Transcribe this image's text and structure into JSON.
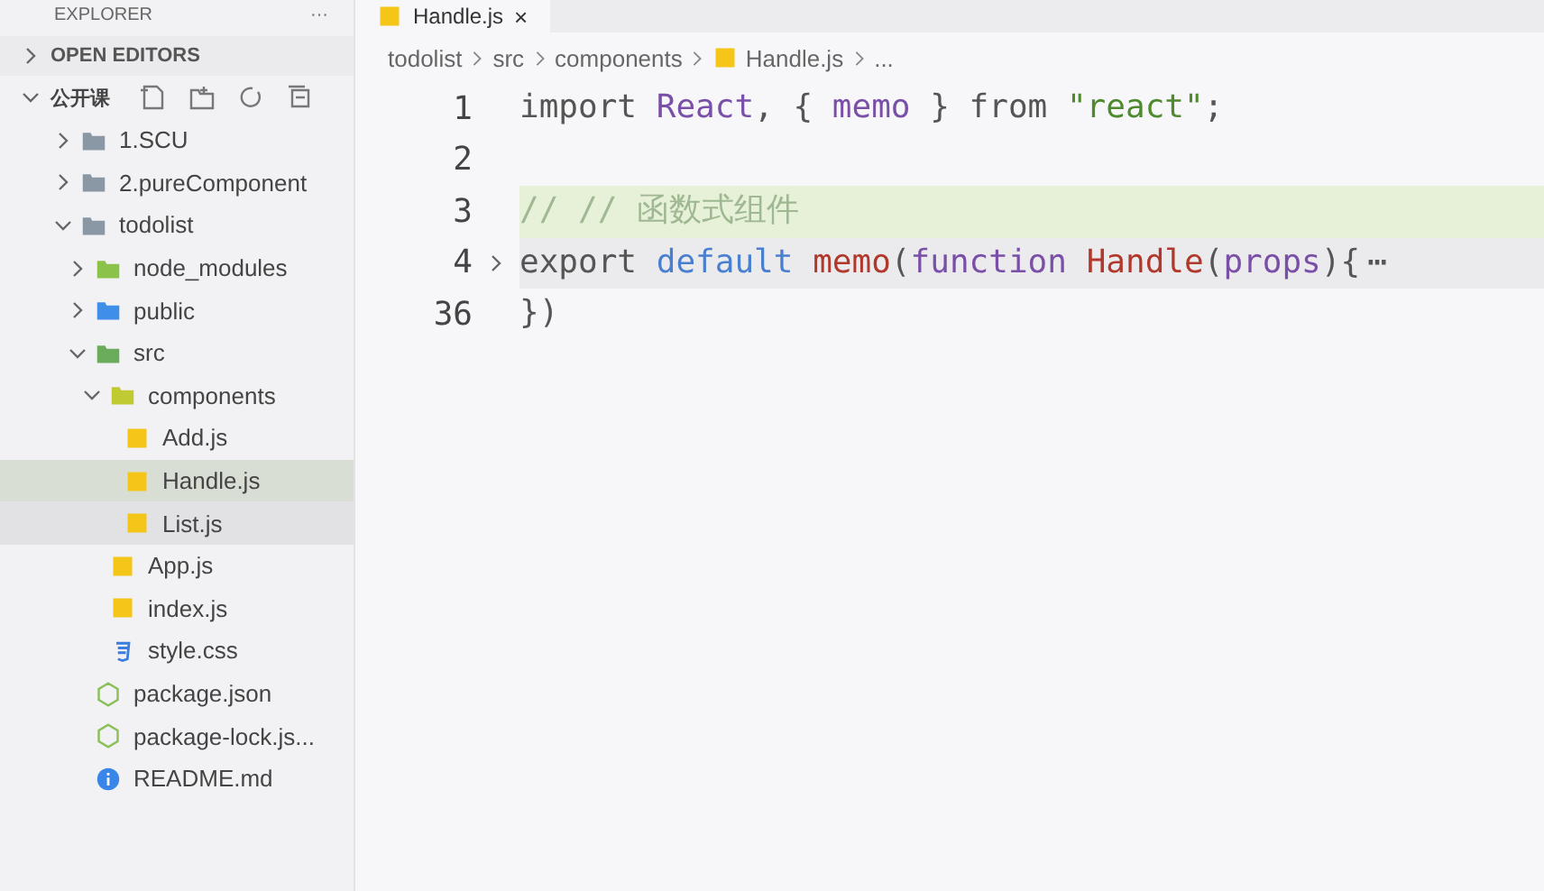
{
  "sidebar": {
    "title": "EXPLORER",
    "more": "···",
    "sections": [
      {
        "label": "OPEN EDITORS",
        "expanded": false
      }
    ],
    "workspace": {
      "label": "公开课",
      "expanded": true,
      "tree": [
        {
          "name": "1.SCU",
          "kind": "folder",
          "expanded": false,
          "selected": false,
          "hovered": false
        },
        {
          "name": "2.pureComponent",
          "kind": "folder",
          "expanded": false,
          "selected": false,
          "hovered": false
        },
        {
          "name": "todolist",
          "kind": "folder",
          "expanded": true,
          "selected": false,
          "hovered": false,
          "children": [
            {
              "name": "node_modules",
              "kind": "node-folder",
              "expanded": false,
              "selected": false,
              "hovered": false
            },
            {
              "name": "public",
              "kind": "public-folder",
              "expanded": false,
              "selected": false,
              "hovered": false
            },
            {
              "name": "src",
              "kind": "src-folder",
              "expanded": true,
              "selected": false,
              "hovered": false,
              "children": [
                {
                  "name": "components",
                  "kind": "component-folder",
                  "expanded": true,
                  "selected": false,
                  "hovered": false,
                  "children": [
                    {
                      "name": "Add.js",
                      "kind": "js",
                      "selected": false,
                      "hovered": false
                    },
                    {
                      "name": "Handle.js",
                      "kind": "js",
                      "selected": true,
                      "hovered": false
                    },
                    {
                      "name": "List.js",
                      "kind": "js",
                      "selected": false,
                      "hovered": true
                    }
                  ]
                },
                {
                  "name": "App.js",
                  "kind": "js",
                  "selected": false,
                  "hovered": false
                },
                {
                  "name": "index.js",
                  "kind": "js",
                  "selected": false,
                  "hovered": false
                },
                {
                  "name": "style.css",
                  "kind": "css",
                  "selected": false,
                  "hovered": false
                }
              ]
            },
            {
              "name": "package.json",
              "kind": "json",
              "selected": false,
              "hovered": false
            },
            {
              "name": "package-lock.js...",
              "kind": "json",
              "selected": false,
              "hovered": false
            },
            {
              "name": "README.md",
              "kind": "info",
              "selected": false,
              "hovered": false
            }
          ]
        }
      ]
    }
  },
  "tabs": [
    {
      "label": "Handle.js",
      "close": "×",
      "selected": true
    }
  ],
  "breadcrumb": [
    "todolist",
    "src",
    "components",
    "Handle.js",
    "..."
  ],
  "code": [
    {
      "number": "1",
      "highlighted": false,
      "folded": false,
      "tokens": [
        {
          "t": "import ",
          "color": "#555555"
        },
        {
          "t": "React",
          "color": "#7a4fa8"
        },
        {
          "t": ", { ",
          "color": "#555555"
        },
        {
          "t": "memo",
          "color": "#7a4fa8"
        },
        {
          "t": " } from ",
          "color": "#555555"
        },
        {
          "t": "\"react\"",
          "color": "#4f8a2f"
        },
        {
          "t": ";",
          "color": "#555555"
        }
      ]
    },
    {
      "number": "2",
      "highlighted": false,
      "folded": false
    },
    {
      "number": "3",
      "highlighted": true,
      "folded": false,
      "tokens": [
        {
          "t": "// // 函数式组件",
          "color": "#9fb892"
        }
      ]
    },
    {
      "number": "4",
      "highlighted": false,
      "folded": true,
      "ellipsis": "⋯",
      "tokens": [
        {
          "t": "export ",
          "color": "#555555"
        },
        {
          "t": "default ",
          "color": "#4a7fd0"
        },
        {
          "t": "memo",
          "color": "#b0392c"
        },
        {
          "t": "(",
          "color": "#555555"
        },
        {
          "t": "function ",
          "color": "#7a4fa8"
        },
        {
          "t": "Handle",
          "color": "#b0392c"
        },
        {
          "t": "(",
          "color": "#555555"
        },
        {
          "t": "props",
          "color": "#7a4fa8"
        },
        {
          "t": "){",
          "color": "#555555"
        }
      ]
    },
    {
      "number": "36",
      "highlighted": false,
      "folded": false,
      "tokens": [
        {
          "t": "})",
          "color": "#555555"
        }
      ]
    }
  ]
}
